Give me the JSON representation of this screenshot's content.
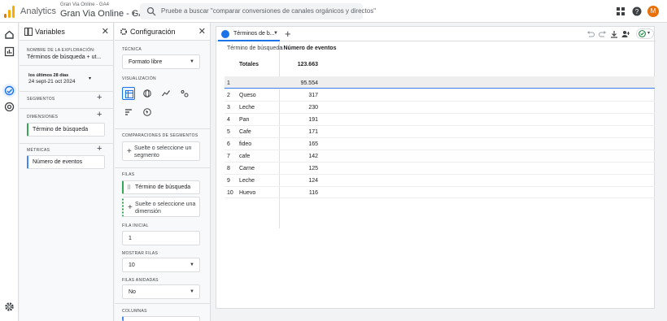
{
  "app": {
    "name": "Analytics",
    "property_small": "Gran Via Online - GA4",
    "property_big": "Gran Via Online - GA4",
    "avatar_letter": "M"
  },
  "search": {
    "placeholder": "Pruebe a buscar \"comparar conversiones de canales orgánicos y directos\""
  },
  "colors": {
    "accent": "#1a73e8",
    "dimension": "#34a853",
    "metric": "#4285f4",
    "logo_orange": "#f9ab00",
    "logo_dark": "#e37400",
    "avatar": "#e8710a"
  },
  "variables": {
    "title": "Variables",
    "exploration_name_label": "NOMBRE DE LA EXPLORACIÓN:",
    "exploration_name": "Términos de búsqueda + ut...",
    "date_range_label": "los últimos 28 días",
    "date_range": "24 sept-21 oct 2024",
    "segments_label": "SEGMENTOS",
    "dimensions_label": "DIMENSIONES",
    "dimension_item": "Término de búsqueda",
    "metrics_label": "MÉTRICAS",
    "metric_item": "Número de eventos"
  },
  "config": {
    "title": "Configuración",
    "technique_label": "TÉCNICA",
    "technique_value": "Formato libre",
    "visualization_label": "VISUALIZACIÓN",
    "segment_comparisons_label": "COMPARACIONES DE SEGMENTOS",
    "segment_drop": "Suelte o seleccione un segmento",
    "rows_label": "FILAS",
    "rows_item": "Término de búsqueda",
    "rows_drop": "Suelte o seleccione una dimensión",
    "start_row_label": "FILA INICIAL",
    "start_row_value": "1",
    "show_rows_label": "MOSTRAR FILAS",
    "show_rows_value": "10",
    "nested_rows_label": "FILAS ANIDADAS",
    "nested_rows_value": "No",
    "columns_label": "COLUMNAS"
  },
  "canvas": {
    "tab_label": "Términos de b...",
    "table": {
      "dim_header": "Término de búsqueda",
      "metric_header": "↓Número de eventos",
      "totals_label": "Totales",
      "totals_value": "123.663",
      "rows": [
        {
          "n": "1",
          "term": "",
          "value": "95.554"
        },
        {
          "n": "2",
          "term": "Queso",
          "value": "317"
        },
        {
          "n": "3",
          "term": "Leche",
          "value": "230"
        },
        {
          "n": "4",
          "term": "Pan",
          "value": "191"
        },
        {
          "n": "5",
          "term": "Cafe",
          "value": "171"
        },
        {
          "n": "6",
          "term": "fideo",
          "value": "165"
        },
        {
          "n": "7",
          "term": "cafe",
          "value": "142"
        },
        {
          "n": "8",
          "term": "Carne",
          "value": "125"
        },
        {
          "n": "9",
          "term": "Leche",
          "value": "124"
        },
        {
          "n": "10",
          "term": "Huevo",
          "value": "116"
        }
      ]
    }
  }
}
